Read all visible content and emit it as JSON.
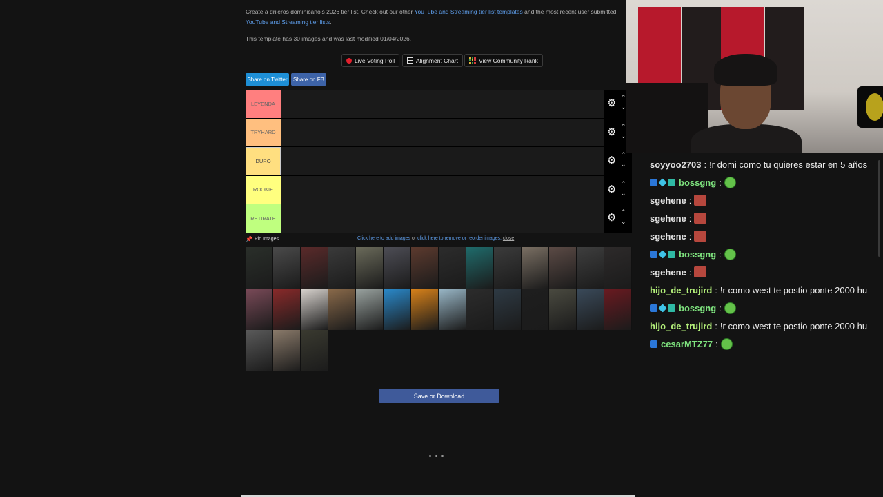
{
  "intro": {
    "prefix": "Create a drileros dominicanois 2026 tier list. Check out our other ",
    "link1": "YouTube and Streaming tier list templates",
    "middle": " and the most recent user submitted ",
    "link2": "YouTube and Streaming tier lists",
    "suffix": "."
  },
  "template_info": "This template has 30 images and was last modified 01/04/2026.",
  "actions": {
    "live_poll": "Live Voting Poll",
    "alignment": "Alignment Chart",
    "community": "View Community Rank"
  },
  "share": {
    "twitter": "Share on Twitter",
    "facebook": "Share on FB"
  },
  "tiers": [
    {
      "label": "LEYENDA",
      "color": "#ff7f7f"
    },
    {
      "label": "TRYHARD",
      "color": "#ffbf7f"
    },
    {
      "label": "DURO",
      "color": "#ffdf80"
    },
    {
      "label": "ROOKIE",
      "color": "#ffff7f"
    },
    {
      "label": "RETIRATE",
      "color": "#bfff7f"
    }
  ],
  "pin_images": "Pin Images",
  "image_tools": {
    "add": "Click here to add images",
    "or": " or ",
    "remove": "click here to remove or reorder images.",
    "close": "close"
  },
  "thumb_colors": [
    "#2a2f2a",
    "#4a4a4a",
    "#5a2a2a",
    "#3a3a3a",
    "#6a6a5a",
    "#4d4d55",
    "#5c3a2e",
    "#2c2c2c",
    "#1f6b6b",
    "#3b3b3b",
    "#7a6f63",
    "#5b4a45",
    "#3e3e3e",
    "#2d2a2a",
    "#7a4a58",
    "#8a2a2a",
    "#d9d4cf",
    "#8a6a4a",
    "#9aa3a0",
    "#2a8acc",
    "#d9821a",
    "#9ab8c8",
    "#2c2c2c",
    "#2e3a44",
    "#1e1e1e",
    "#4a4a40",
    "#3a4a5a",
    "#6a1a20",
    "#5a5a5a",
    "#8a7a6a",
    "#3a3a30"
  ],
  "save_label": "Save or Download",
  "chat": [
    {
      "user": "soyyoo2703",
      "color": "#e0e0e0",
      "badges": false,
      "text": "!r domi como tu quieres estar en 5 años",
      "emote": ""
    },
    {
      "user": "bossgng",
      "color": "#7ee27e",
      "badges": true,
      "text": "",
      "emote": "frog"
    },
    {
      "user": "sgehene",
      "color": "#e0e0e0",
      "badges": false,
      "text": "",
      "emote": "face"
    },
    {
      "user": "sgehene",
      "color": "#e0e0e0",
      "badges": false,
      "text": "",
      "emote": "face"
    },
    {
      "user": "sgehene",
      "color": "#e0e0e0",
      "badges": false,
      "text": "",
      "emote": "face"
    },
    {
      "user": "bossgng",
      "color": "#7ee27e",
      "badges": true,
      "text": "",
      "emote": "frog"
    },
    {
      "user": "sgehene",
      "color": "#e0e0e0",
      "badges": false,
      "text": "",
      "emote": "face"
    },
    {
      "user": "hijo_de_trujird",
      "color": "#b4f07a",
      "badges": false,
      "text": "!r como west te postio ponte 2000 hu",
      "emote": ""
    },
    {
      "user": "bossgng",
      "color": "#7ee27e",
      "badges": true,
      "text": "",
      "emote": "frog"
    },
    {
      "user": "hijo_de_trujird",
      "color": "#b4f07a",
      "badges": false,
      "text": "!r como west te postio ponte 2000 hu",
      "emote": ""
    },
    {
      "user": "cesarMTZ77",
      "color": "#7ee27e",
      "badges": "single",
      "text": "",
      "emote": "frog"
    }
  ]
}
